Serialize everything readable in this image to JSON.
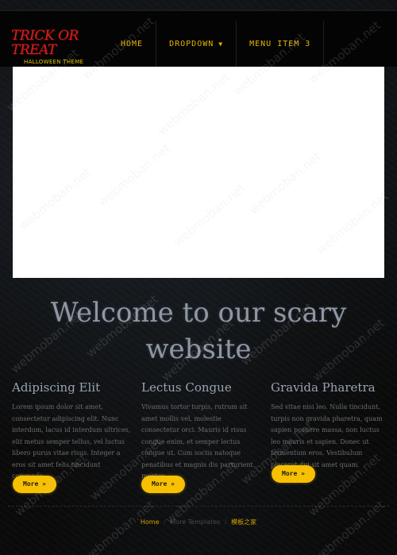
{
  "logo": {
    "title": "TRICK OR TREAT",
    "subtitle": "HALLOWEEN THEME"
  },
  "nav": {
    "items": [
      {
        "label": "HOME"
      },
      {
        "label": "DROPDOWN",
        "has_caret": true
      },
      {
        "label": "MENU ITEM 3"
      }
    ]
  },
  "welcome": {
    "heading": "Welcome to our scary website"
  },
  "columns": [
    {
      "title": "Adipiscing Elit",
      "text": "Lorem ipsum dolor sit amet, consectetur adipiscing elit. Nunc interdum, lacus id interdum ultrices, elit metus semper tellus, vel luctus libero purus vitae risus. Integer a eros sit amet felis tincidunt commodo.",
      "button": "More »"
    },
    {
      "title": "Lectus Congue",
      "text": "Vivamus tortor turpis, rutrum sit amet mollis vel, molestie consectetur orci. Mauris id risus congue enim, et semper lectus congue ut. Cum sociis natoque penatibus et magnis dis parturient montes.",
      "button": "More »"
    },
    {
      "title": "Gravida Pharetra",
      "text": "Sed vitae nisi leo. Nulla tincidunt, turpis non gravida pharetra, quam sapien posuere massa, non luctus leo mauris et sapien. Donec ut fermentum eros. Vestibulum placerat dui sit amet quam.",
      "button": "More »"
    }
  ],
  "breadcrumb": {
    "home": "Home",
    "more": "More Templates",
    "site": "模板之家",
    "separator": "/"
  },
  "watermark": {
    "text": "webmoban.net"
  },
  "colors": {
    "accent": "#f7c000",
    "logo_red": "#d42020",
    "heading": "#8f97a4"
  }
}
